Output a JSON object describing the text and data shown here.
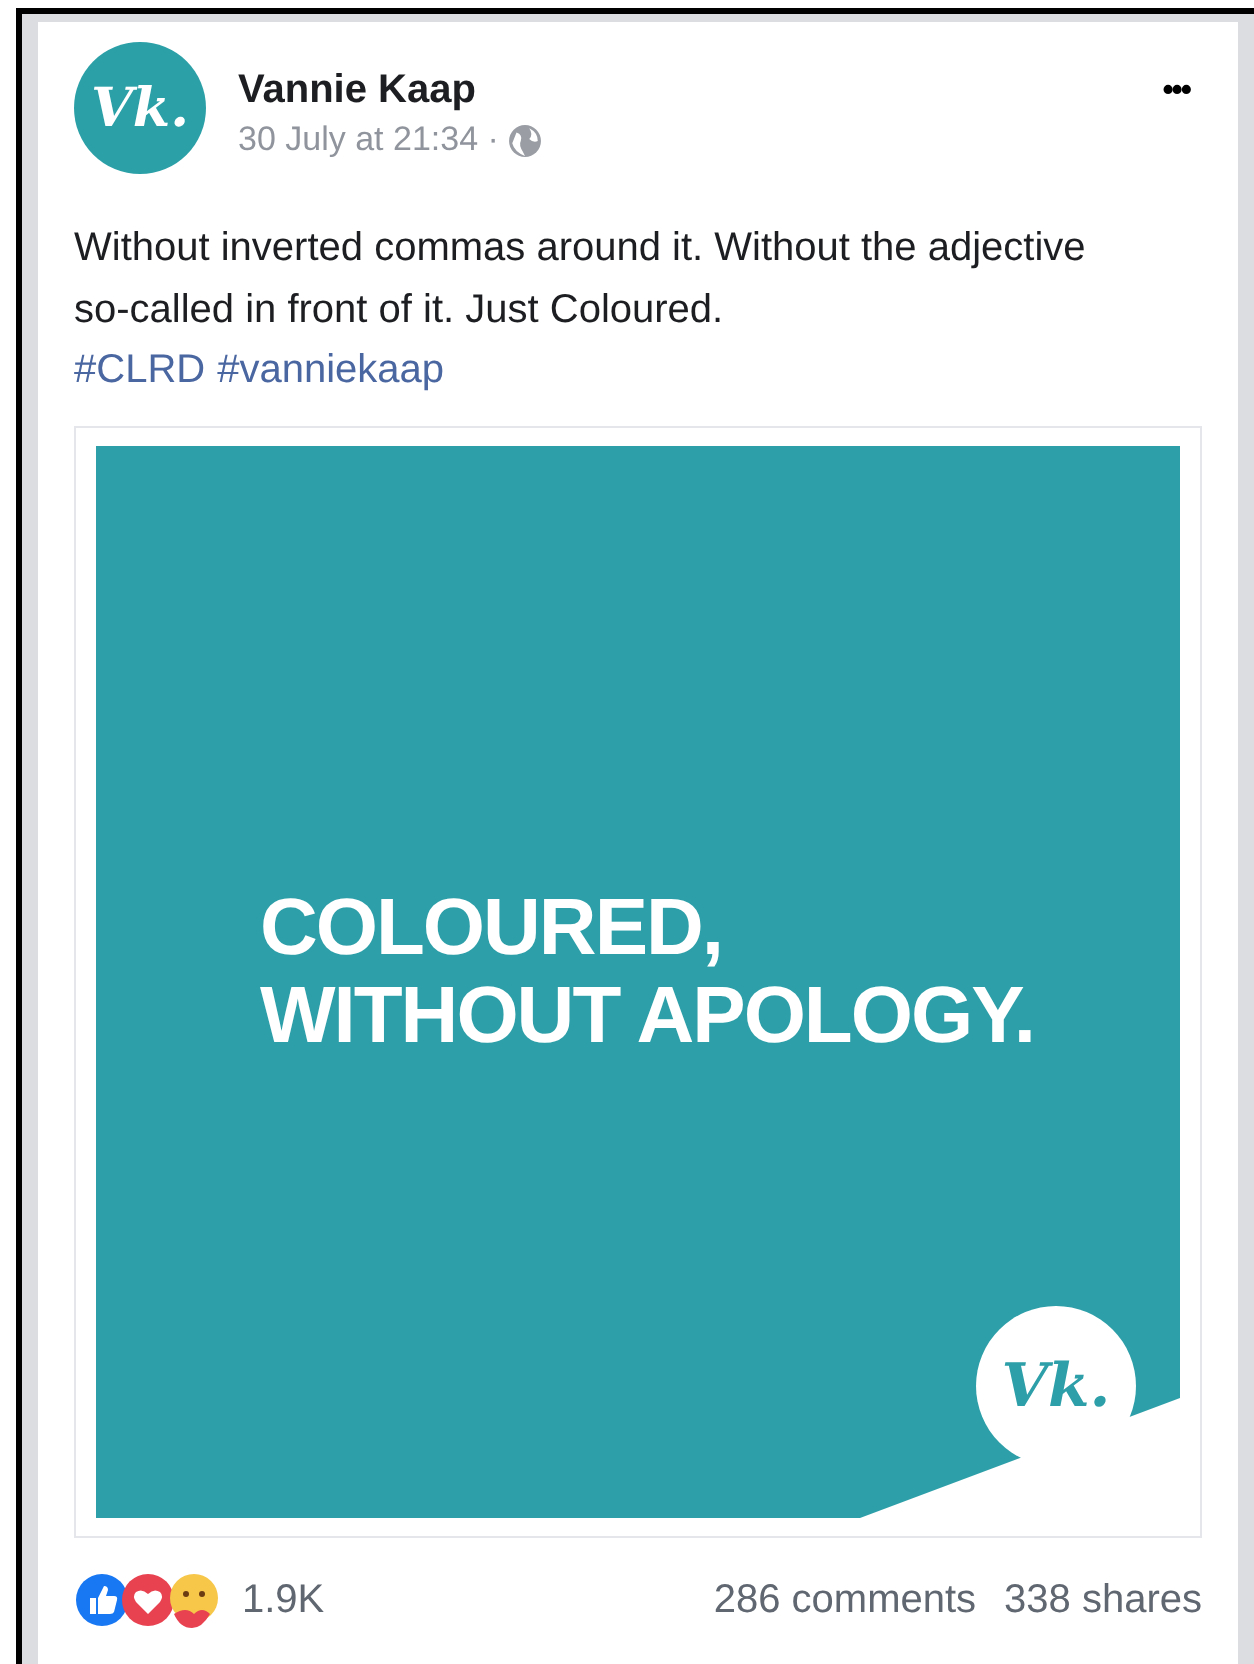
{
  "post": {
    "avatar_text": "Vk.",
    "author": "Vannie Kaap",
    "time": "30 July at 21:34 ·",
    "more": "•••",
    "text": "Without inverted commas around it. Without the adjective so-called in front of it. Just Coloured.",
    "hashtags": [
      "#CLRD",
      "#vanniekaap"
    ],
    "graphic": {
      "lines": [
        "COLOURED,",
        "WITHOUT APOLOGY."
      ],
      "logo_text": "Vk."
    },
    "reactions_count": "1.9K",
    "comments": "286 comments",
    "shares": "338 shares"
  }
}
